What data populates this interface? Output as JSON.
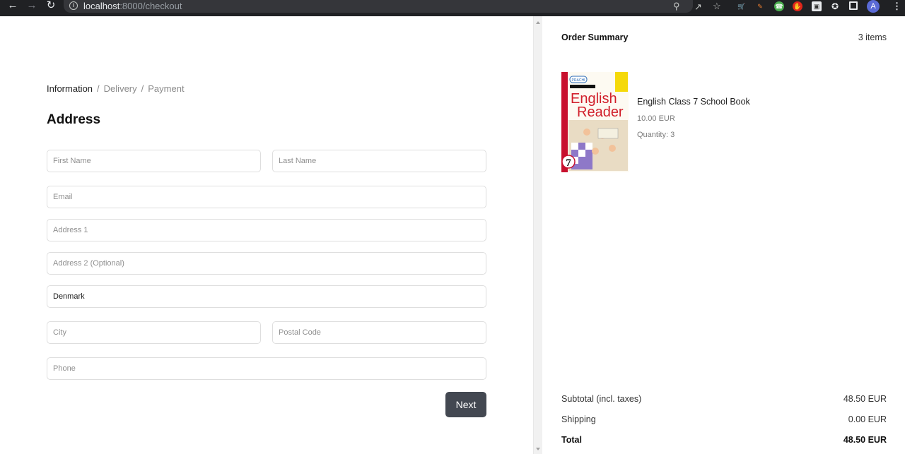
{
  "browser": {
    "url_host": "localhost",
    "url_path": ":8000/checkout",
    "icons": [
      "back-icon",
      "forward-icon",
      "reload-icon",
      "info-icon",
      "zoom-icon",
      "share-icon",
      "bookmark-star-icon",
      "cart-extension-icon",
      "color-picker-extension-icon",
      "whatsapp-extension-icon",
      "adblock-extension-icon",
      "screen-extension-icon",
      "extensions-puzzle-icon",
      "side-panel-icon",
      "profile-avatar",
      "menu-icon"
    ],
    "avatar_letter": "A"
  },
  "checkout": {
    "breadcrumb": [
      {
        "label": "Information",
        "active": true
      },
      {
        "label": "Delivery",
        "active": false
      },
      {
        "label": "Payment",
        "active": false
      }
    ],
    "breadcrumb_separator": "/",
    "title": "Address",
    "fields": {
      "first_name": {
        "placeholder": "First Name",
        "value": ""
      },
      "last_name": {
        "placeholder": "Last Name",
        "value": ""
      },
      "email": {
        "placeholder": "Email",
        "value": ""
      },
      "address1": {
        "placeholder": "Address 1",
        "value": ""
      },
      "address2": {
        "placeholder": "Address 2 (Optional)",
        "value": ""
      },
      "country": {
        "value": "Denmark"
      },
      "city": {
        "placeholder": "City",
        "value": ""
      },
      "postal_code": {
        "placeholder": "Postal Code",
        "value": ""
      },
      "phone": {
        "placeholder": "Phone",
        "value": ""
      }
    },
    "next_label": "Next",
    "button_color": "#434851"
  },
  "summary": {
    "title": "Order Summary",
    "item_count": "3 items",
    "items": [
      {
        "name": "English Class 7 School Book",
        "price": "10.00 EUR",
        "quantity": "Quantity: 3",
        "cover_title_1": "English",
        "cover_title_2": "Reader",
        "cover_number": "7",
        "cover_publisher": "PRACHI"
      }
    ],
    "subtotal_label": "Subtotal (incl. taxes)",
    "subtotal": "48.50 EUR",
    "shipping_label": "Shipping",
    "shipping": "0.00 EUR",
    "total_label": "Total",
    "total": "48.50 EUR"
  }
}
